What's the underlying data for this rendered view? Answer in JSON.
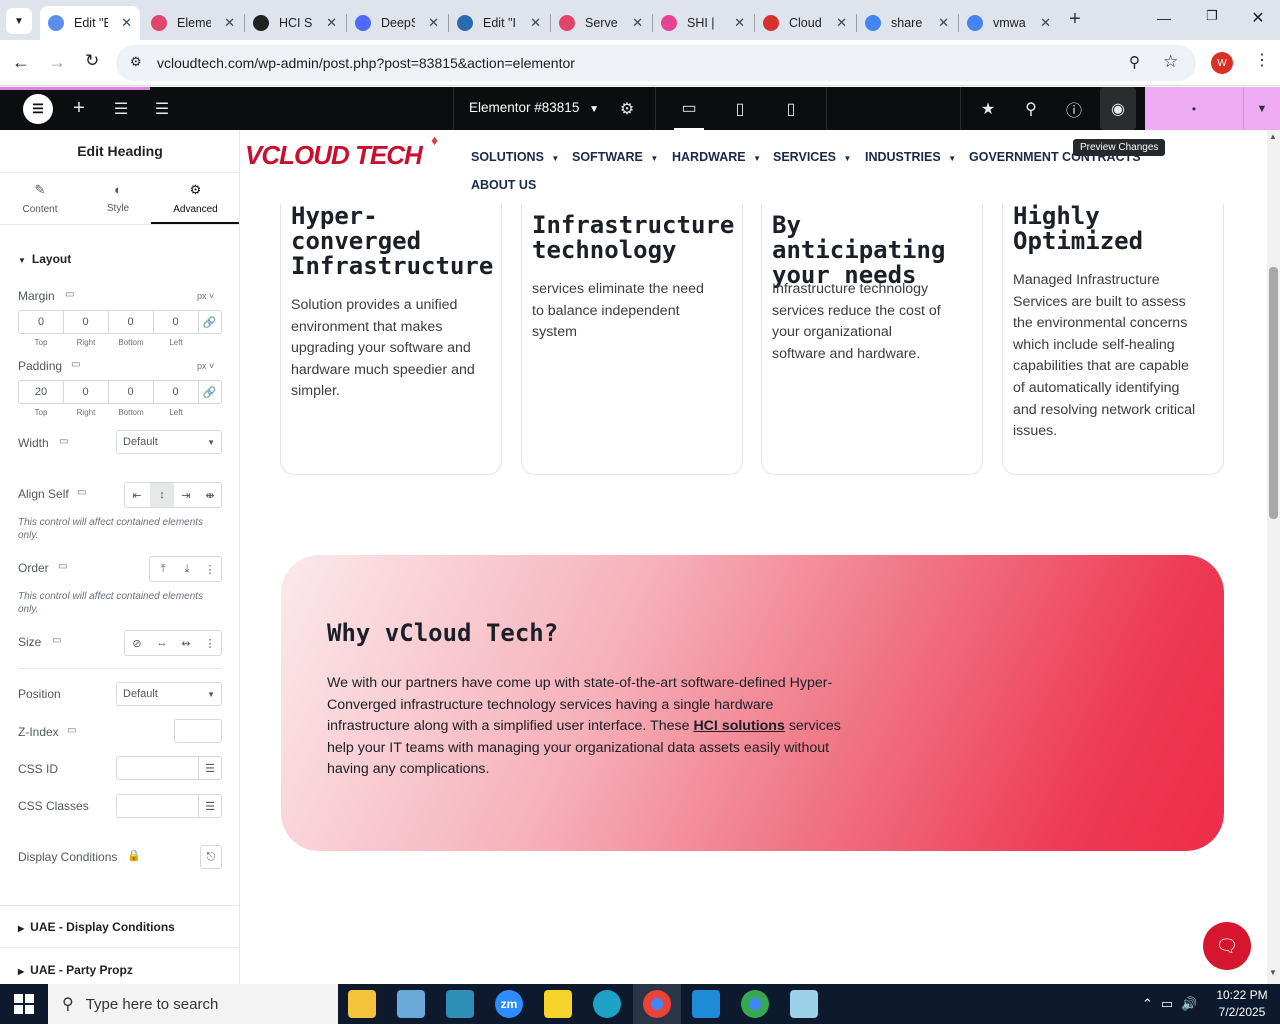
{
  "browser": {
    "tabs": [
      {
        "title": "Edit \"E",
        "active": true,
        "color": "#5b8def"
      },
      {
        "title": "Eleme",
        "color": "#e2456c"
      },
      {
        "title": "HCI S",
        "color": "#222222"
      },
      {
        "title": "DeepS",
        "color": "#4d6bfe"
      },
      {
        "title": "Edit \"I",
        "color": "#2b6cb0"
      },
      {
        "title": "Serve",
        "color": "#e2456c"
      },
      {
        "title": "SHI |",
        "color": "#e84393"
      },
      {
        "title": "Cloud",
        "color": "#d63031"
      },
      {
        "title": "share",
        "color": "#4285f4"
      },
      {
        "title": "vmwa",
        "color": "#4285f4"
      }
    ],
    "url": "vcloudtech.com/wp-admin/post.php?post=83815&action=elementor",
    "profile_initial": "W"
  },
  "elementor_bar": {
    "document_title": "Elementor #83815",
    "tooltip": "Preview Changes"
  },
  "panel": {
    "header": "Edit Heading",
    "tabs": [
      {
        "label": "Content"
      },
      {
        "label": "Style"
      },
      {
        "label": "Advanced"
      }
    ],
    "section_title": "Layout",
    "margin": {
      "label": "Margin",
      "unit": "px",
      "values": [
        "0",
        "0",
        "0",
        "0"
      ]
    },
    "padding": {
      "label": "Padding",
      "unit": "px",
      "values": [
        "20",
        "0",
        "0",
        "0"
      ]
    },
    "dim_labels": [
      "Top",
      "Right",
      "Bottom",
      "Left"
    ],
    "width": {
      "label": "Width",
      "value": "Default"
    },
    "align_self": {
      "label": "Align Self"
    },
    "note_text": "This control will affect contained elements only.",
    "order": {
      "label": "Order"
    },
    "size": {
      "label": "Size"
    },
    "position": {
      "label": "Position",
      "value": "Default"
    },
    "zindex": {
      "label": "Z-Index"
    },
    "css_id": {
      "label": "CSS ID"
    },
    "css_classes": {
      "label": "CSS Classes"
    },
    "display_conditions": {
      "label": "Display Conditions"
    },
    "sections": [
      "UAE - Display Conditions",
      "UAE - Party Propz"
    ]
  },
  "site": {
    "logo": "VCLOUD TECH",
    "nav": [
      "SOLUTIONS",
      "SOFTWARE",
      "HARDWARE",
      "SERVICES",
      "INDUSTRIES",
      "GOVERNMENT CONTRACTS",
      "ABOUT US"
    ],
    "cards": [
      {
        "title_lines": [
          "Hyper-",
          "converged",
          "Infrastructure"
        ],
        "body_lines": [
          "Solution provides a unified",
          "environment that makes",
          "upgrading your software and",
          "hardware much speedier and",
          "simpler."
        ]
      },
      {
        "title_lines": [
          "Infrastructure",
          "technology"
        ],
        "body_lines": [
          "services eliminate the need",
          "to balance independent",
          "system"
        ]
      },
      {
        "title_lines": [
          "By anticipating",
          "your needs"
        ],
        "body_lines": [
          "Infrastructure technology",
          "services reduce the cost of",
          "your organizational",
          "software and hardware."
        ]
      },
      {
        "title_lines": [
          "Highly",
          "Optimized"
        ],
        "body_lines": [
          "Managed Infrastructure",
          "Services are built to assess",
          "the environmental concerns",
          "which include self-healing",
          "capabilities that are capable",
          "of automatically identifying",
          "and resolving network critical",
          "issues."
        ]
      }
    ],
    "why": {
      "title": "Why vCloud Tech?",
      "line1": "We with our partners have come up with state-of-the-art software-defined Hyper-",
      "line2": "Converged infrastructure technology services having a single hardware",
      "line3_before": "infrastructure along with a simplified user interface. These ",
      "line3_link": "HCI solutions",
      "line3_after": " services",
      "line4": "help your IT teams with managing your organizational data assets easily without",
      "line5": "having any complications."
    }
  },
  "taskbar": {
    "search_placeholder": "Type here to search",
    "time": "10:22 PM",
    "date": "7/2/2025"
  }
}
